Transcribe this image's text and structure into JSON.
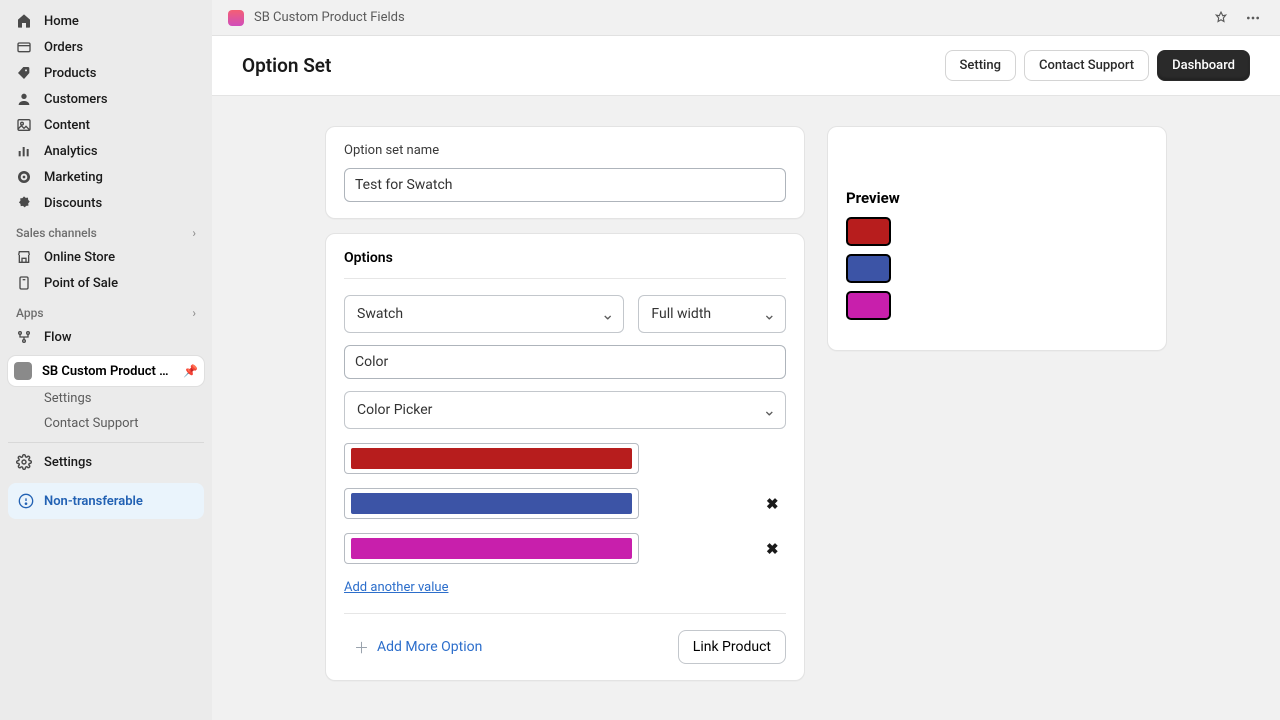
{
  "sidebar": {
    "nav": [
      {
        "id": "home",
        "label": "Home"
      },
      {
        "id": "orders",
        "label": "Orders"
      },
      {
        "id": "products",
        "label": "Products"
      },
      {
        "id": "customers",
        "label": "Customers"
      },
      {
        "id": "content",
        "label": "Content"
      },
      {
        "id": "analytics",
        "label": "Analytics"
      },
      {
        "id": "marketing",
        "label": "Marketing"
      },
      {
        "id": "discounts",
        "label": "Discounts"
      }
    ],
    "sales_channels_label": "Sales channels",
    "sales_channels": [
      {
        "id": "online-store",
        "label": "Online Store"
      },
      {
        "id": "pos",
        "label": "Point of Sale"
      }
    ],
    "apps_label": "Apps",
    "apps": [
      {
        "id": "flow",
        "label": "Flow"
      }
    ],
    "active_app": {
      "label": "SB Custom Product Fi..."
    },
    "active_app_sub": [
      {
        "id": "settings",
        "label": "Settings"
      },
      {
        "id": "contact-support",
        "label": "Contact Support"
      }
    ],
    "settings_label": "Settings",
    "non_transferable": "Non-transferable"
  },
  "topbar": {
    "app_name": "SB Custom Product Fields"
  },
  "header": {
    "title": "Option Set",
    "buttons": {
      "setting": "Setting",
      "contact_support": "Contact Support",
      "dashboard": "Dashboard"
    }
  },
  "form": {
    "option_set_name_label": "Option set name",
    "option_set_name_value": "Test for Swatch",
    "options_heading": "Options",
    "type_select": "Swatch",
    "width_select": "Full width",
    "label_input": "Color",
    "value_mode": "Color Picker",
    "swatches": [
      {
        "color": "#b71d1d",
        "removable": false
      },
      {
        "color": "#3c54a6",
        "removable": true
      },
      {
        "color": "#c81fac",
        "removable": true
      }
    ],
    "add_another_value": "Add another value",
    "add_more_option": "Add More Option",
    "link_product": "Link Product"
  },
  "preview": {
    "title": "Preview",
    "colors": [
      "#b71d1d",
      "#3c54a6",
      "#c81fac"
    ]
  }
}
